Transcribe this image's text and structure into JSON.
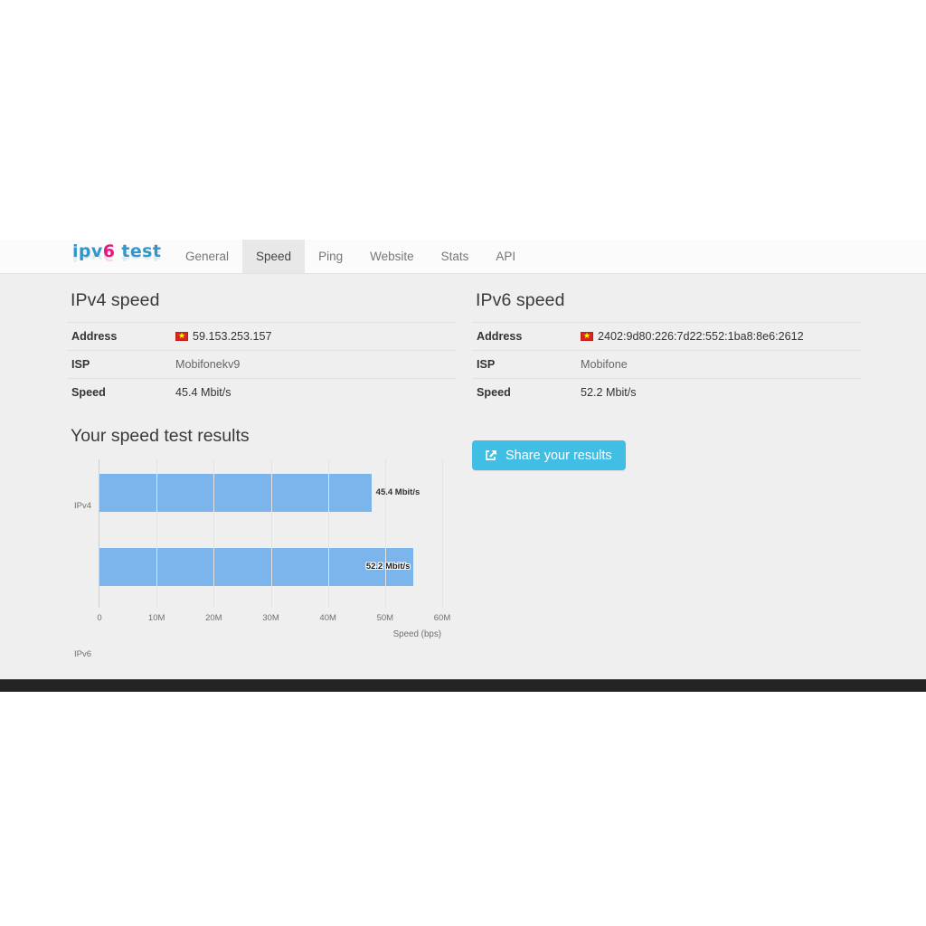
{
  "site": {
    "logo_text_part1": "ipv",
    "logo_text_six": "6",
    "logo_text_part2": " test"
  },
  "nav": {
    "tabs": [
      {
        "label": "General",
        "active": false
      },
      {
        "label": "Speed",
        "active": true
      },
      {
        "label": "Ping",
        "active": false
      },
      {
        "label": "Website",
        "active": false
      },
      {
        "label": "Stats",
        "active": false
      },
      {
        "label": "API",
        "active": false
      }
    ]
  },
  "ipv4_panel": {
    "title": "IPv4 speed",
    "rows": [
      {
        "label": "Address",
        "value": "59.153.253.157",
        "flag": "vietnam-flag-icon"
      },
      {
        "label": "ISP",
        "value": "Mobifonekv9"
      },
      {
        "label": "Speed",
        "value": "45.4 Mbit/s"
      }
    ]
  },
  "ipv6_panel": {
    "title": "IPv6 speed",
    "rows": [
      {
        "label": "Address",
        "value": "2402:9d80:226:7d22:552:1ba8:8e6:2612",
        "flag": "vietnam-flag-icon"
      },
      {
        "label": "ISP",
        "value": "Mobifone"
      },
      {
        "label": "Speed",
        "value": "52.2 Mbit/s"
      }
    ]
  },
  "chart_data": {
    "type": "bar",
    "orientation": "horizontal",
    "title": "Your speed test results",
    "categories": [
      "IPv4",
      "IPv6"
    ],
    "values": [
      47600000,
      55000000
    ],
    "data_labels": [
      "45.4 Mbit/s",
      "52.2 Mbit/s"
    ],
    "xlabel": "Speed (bps)",
    "ylabel": "",
    "xlim": [
      0,
      60000000
    ],
    "xticks": [
      0,
      10000000,
      20000000,
      30000000,
      40000000,
      50000000,
      60000000
    ],
    "xtick_labels": [
      "0",
      "10M",
      "20M",
      "30M",
      "40M",
      "50M",
      "60M"
    ],
    "grid": true,
    "legend": false,
    "bar_color": "#7cb5ec"
  },
  "share": {
    "label": "Share your results",
    "icon": "share-external-icon",
    "color": "#41bee3"
  },
  "colors": {
    "page_background": "#efefef",
    "nav_background": "#fbfbfb",
    "active_tab": "#e8e8e8",
    "logo_blue": "#3296cc",
    "logo_pink": "#e5197f",
    "footer": "#232323"
  }
}
